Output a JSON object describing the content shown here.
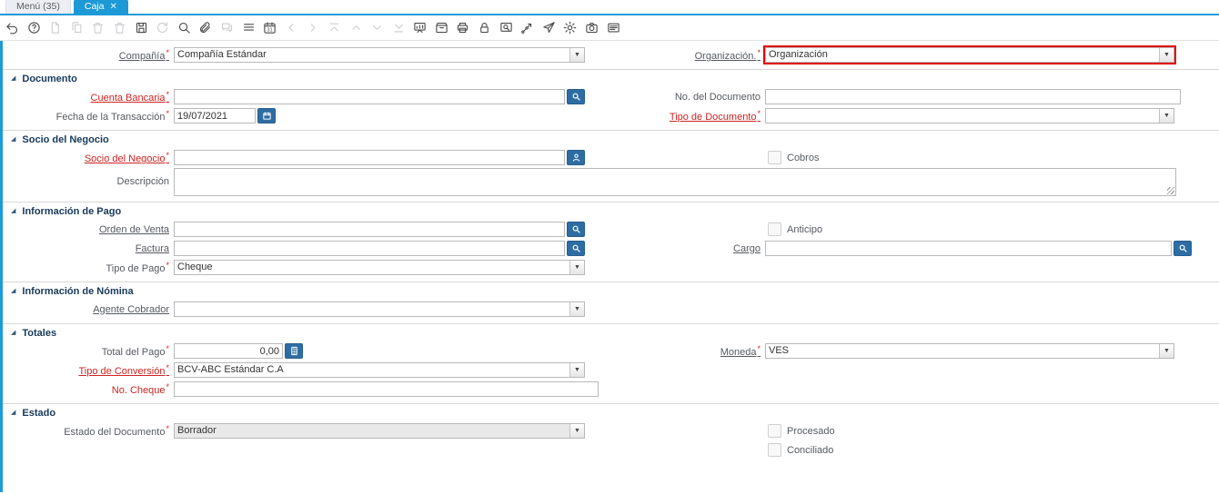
{
  "colors": {
    "accent_blue": "#1d9ad6",
    "field_button_blue": "#2e6da4",
    "highlight_border": "#e20000",
    "mandatory_red": "#cf2323"
  },
  "tabs": {
    "menu": {
      "label": "Menú (35)"
    },
    "caja": {
      "label": "Caja",
      "close": "✕"
    }
  },
  "toolbar": {
    "icons": [
      {
        "name": "undo-icon",
        "enabled": true
      },
      {
        "name": "help-icon",
        "enabled": true
      },
      {
        "name": "new-record-icon",
        "enabled": false
      },
      {
        "name": "copy-record-icon",
        "enabled": false
      },
      {
        "name": "delete-record-icon",
        "enabled": false
      },
      {
        "name": "delete-selection-icon",
        "enabled": false
      },
      {
        "name": "save-icon",
        "enabled": true
      },
      {
        "name": "requery-icon",
        "enabled": false
      },
      {
        "name": "find-icon",
        "enabled": true
      },
      {
        "name": "attachment-icon",
        "enabled": true
      },
      {
        "name": "chat-icon",
        "enabled": false
      },
      {
        "name": "grid-toggle-icon",
        "enabled": true
      },
      {
        "name": "calendar-icon",
        "enabled": true
      },
      {
        "name": "chevron-left-icon",
        "enabled": false
      },
      {
        "name": "chevron-right-icon",
        "enabled": false
      },
      {
        "name": "first-record-icon",
        "enabled": false
      },
      {
        "name": "prev-record-icon",
        "enabled": false
      },
      {
        "name": "next-record-icon",
        "enabled": false
      },
      {
        "name": "last-record-icon",
        "enabled": false
      },
      {
        "name": "report-icon",
        "enabled": true
      },
      {
        "name": "archive-icon",
        "enabled": true
      },
      {
        "name": "print-icon",
        "enabled": true
      },
      {
        "name": "lock-icon",
        "enabled": true
      },
      {
        "name": "zoom-across-icon",
        "enabled": true
      },
      {
        "name": "workflow-icon",
        "enabled": true
      },
      {
        "name": "send-mail-icon",
        "enabled": true
      },
      {
        "name": "preference-icon",
        "enabled": true
      },
      {
        "name": "capture-icon",
        "enabled": true
      },
      {
        "name": "quick-form-icon",
        "enabled": true
      }
    ]
  },
  "header_row": {
    "compania": {
      "label": "Compañía",
      "value": "Compañía Estándar",
      "required": true
    },
    "organizacion": {
      "label": "Organización.",
      "value": "Organización",
      "required": true,
      "highlighted": true
    }
  },
  "sections": {
    "documento": {
      "title": "Documento",
      "cuenta_bancaria": {
        "label": "Cuenta Bancaria",
        "value": "",
        "required": true
      },
      "no_documento": {
        "label": "No. del Documento",
        "value": ""
      },
      "fecha": {
        "label": "Fecha de la Transacción",
        "value": "19/07/2021",
        "required": true
      },
      "tipo_documento": {
        "label": "Tipo de Documento",
        "value": "",
        "required": true
      }
    },
    "socio": {
      "title": "Socio del Negocio",
      "socio": {
        "label": "Socio del Negocio",
        "value": "",
        "required": true
      },
      "cobros": {
        "label": "Cobros",
        "checked": false
      },
      "descripcion": {
        "label": "Descripción",
        "value": ""
      }
    },
    "pago": {
      "title": "Información de Pago",
      "orden_venta": {
        "label": "Orden de Venta",
        "value": ""
      },
      "anticipo": {
        "label": "Anticipo",
        "checked": false
      },
      "factura": {
        "label": "Factura",
        "value": ""
      },
      "cargo": {
        "label": "Cargo",
        "value": ""
      },
      "tipo_pago": {
        "label": "Tipo de Pago",
        "value": "Cheque",
        "required": true
      }
    },
    "nomina": {
      "title": "Información de Nómina",
      "agente": {
        "label": "Agente Cobrador",
        "value": ""
      }
    },
    "totales": {
      "title": "Totales",
      "total": {
        "label": "Total del Pago",
        "value": "0,00",
        "required": true
      },
      "moneda": {
        "label": "Moneda",
        "value": "VES",
        "required": true
      },
      "tipo_conversion": {
        "label": "Tipo de Conversión",
        "value": "BCV-ABC Estándar C.A",
        "required": true
      },
      "no_cheque": {
        "label": "No. Cheque",
        "value": "",
        "required": true
      }
    },
    "estado": {
      "title": "Estado",
      "estado_doc": {
        "label": "Estado del Documento",
        "value": "Borrador",
        "required": true,
        "disabled": true
      },
      "procesado": {
        "label": "Procesado",
        "checked": false
      },
      "conciliado": {
        "label": "Conciliado",
        "checked": false
      }
    }
  }
}
